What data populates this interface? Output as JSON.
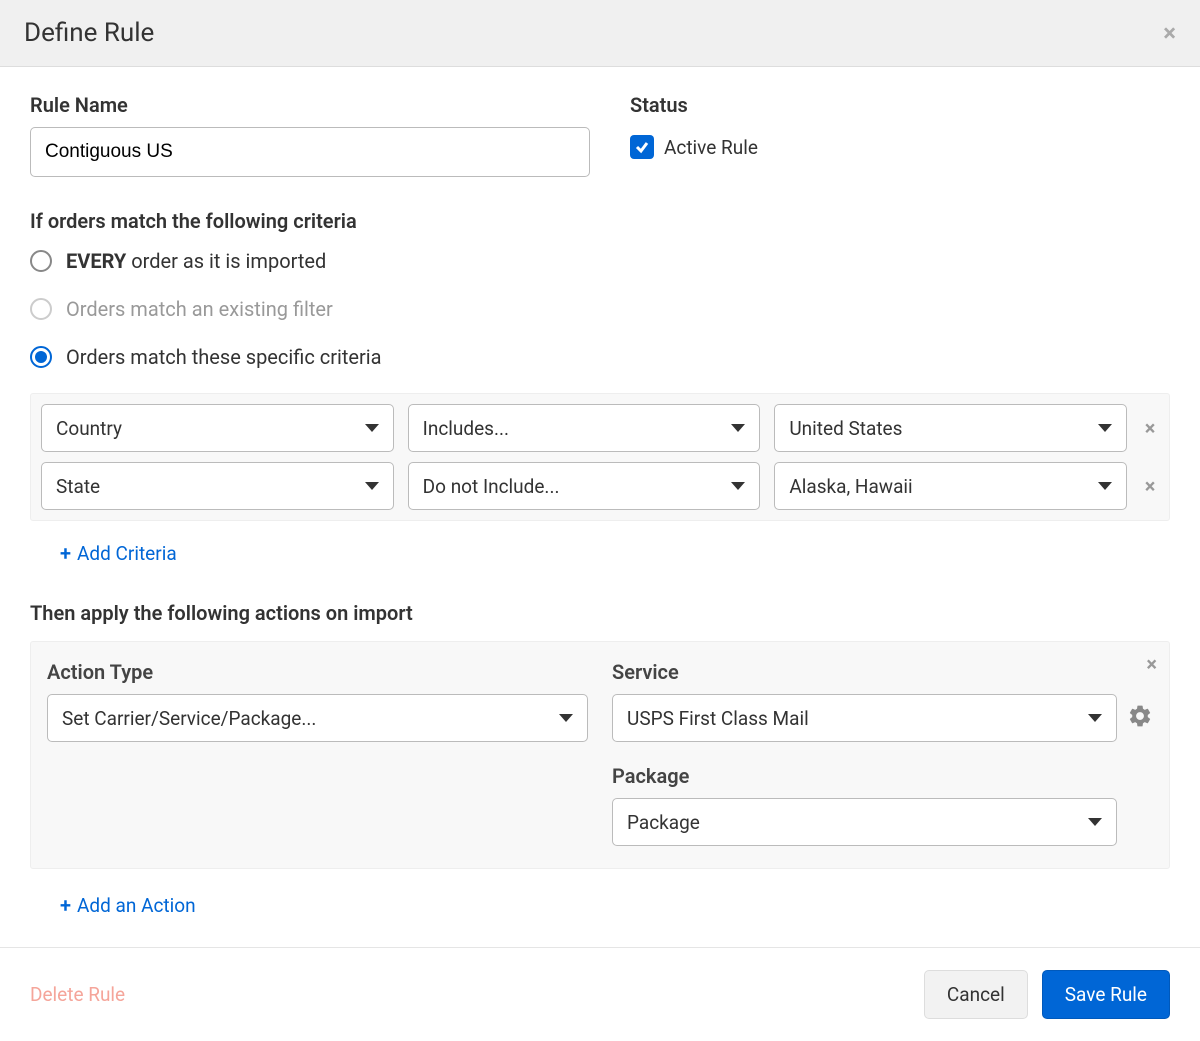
{
  "header": {
    "title": "Define Rule"
  },
  "ruleName": {
    "label": "Rule Name",
    "value": "Contiguous US"
  },
  "status": {
    "label": "Status",
    "checkboxLabel": "Active Rule",
    "checked": true
  },
  "criteriaSection": {
    "heading": "If orders match the following criteria",
    "options": {
      "every_bold": "EVERY",
      "every_rest": " order as it is imported",
      "filter": "Orders match an existing filter",
      "specific": "Orders match these specific criteria"
    },
    "rows": [
      {
        "field": "Country",
        "operator": "Includes...",
        "value": "United States"
      },
      {
        "field": "State",
        "operator": "Do not Include...",
        "value": "Alaska, Hawaii"
      }
    ],
    "addLabel": "Add Criteria"
  },
  "actionsSection": {
    "heading": "Then apply the following actions on import",
    "action": {
      "typeLabel": "Action Type",
      "typeValue": "Set Carrier/Service/Package...",
      "serviceLabel": "Service",
      "serviceValue": "USPS First Class Mail",
      "packageLabel": "Package",
      "packageValue": "Package"
    },
    "addLabel": "Add an Action"
  },
  "footer": {
    "deleteLabel": "Delete Rule",
    "cancelLabel": "Cancel",
    "saveLabel": "Save Rule"
  }
}
